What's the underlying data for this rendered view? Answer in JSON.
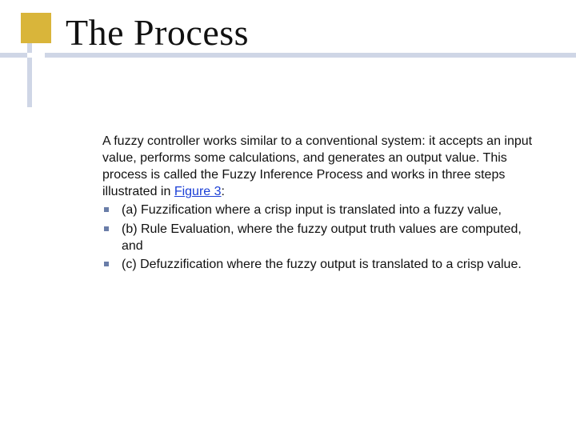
{
  "title": "The Process",
  "intro_prefix": "A fuzzy controller works similar to a conventional system: it accepts an input value, performs some calculations, and generates an output value. This process is called the Fuzzy Inference Process and works in three steps illustrated in ",
  "intro_link": "Figure 3",
  "intro_suffix": ":",
  "bullets": [
    " (a) Fuzzification where a crisp input is translated into a fuzzy value,",
    "(b) Rule Evaluation, where the fuzzy output truth values are computed, and",
    " (c) Defuzzification where the fuzzy output is translated to a crisp value."
  ]
}
